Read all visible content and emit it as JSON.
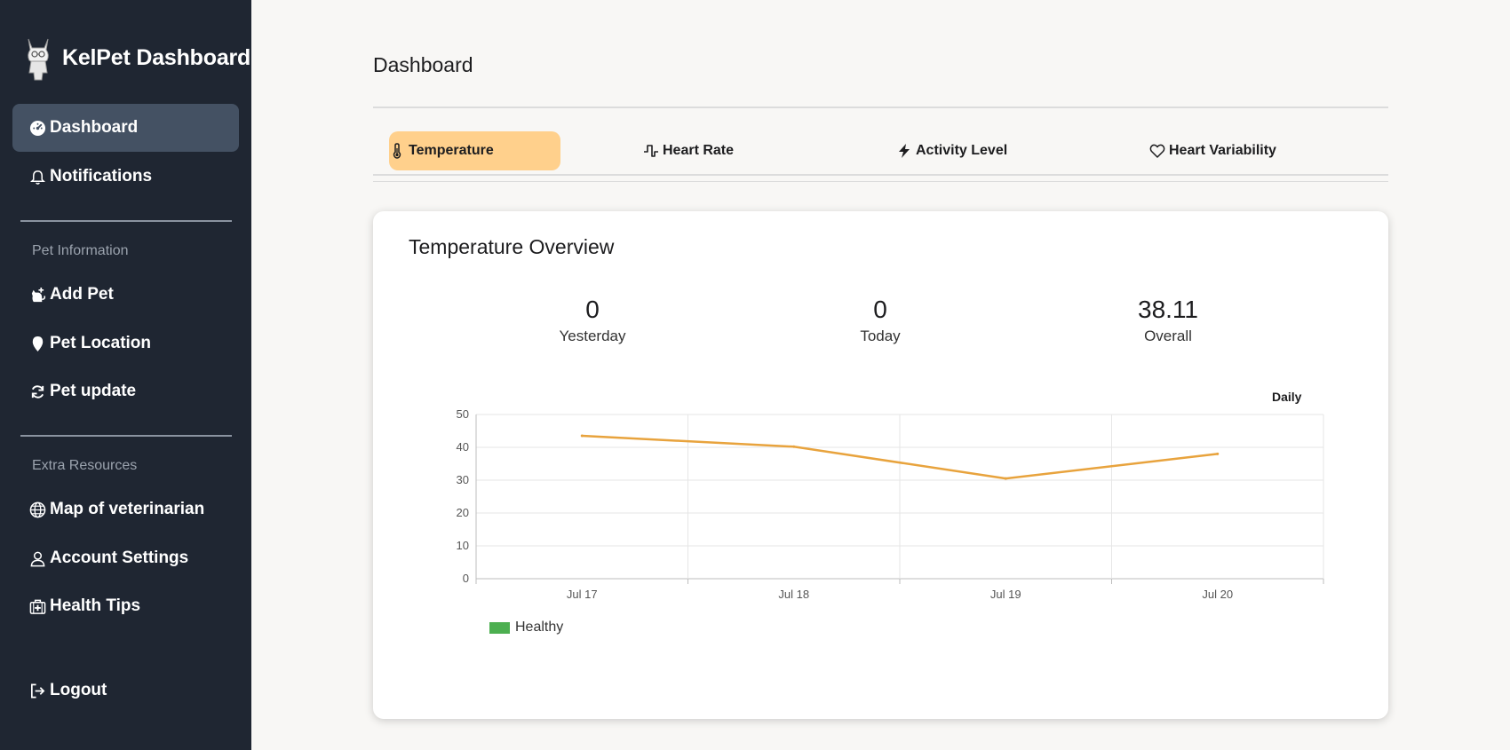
{
  "sidebar": {
    "brand": "KelPet Dashboard",
    "items": [
      {
        "label": "Dashboard",
        "icon": "dashboard-gauge-icon",
        "active": true
      },
      {
        "label": "Notifications",
        "icon": "bell-icon"
      }
    ],
    "sections": [
      {
        "label": "Pet Information",
        "items": [
          {
            "label": "Add Pet",
            "icon": "cat-add-icon"
          },
          {
            "label": "Pet Location",
            "icon": "map-pin-icon"
          },
          {
            "label": "Pet update",
            "icon": "refresh-icon"
          }
        ]
      },
      {
        "label": "Extra Resources",
        "items": [
          {
            "label": "Map of veterinarian",
            "icon": "globe-icon"
          },
          {
            "label": "Account Settings",
            "icon": "user-icon"
          },
          {
            "label": "Health Tips",
            "icon": "medical-kit-icon"
          }
        ]
      }
    ],
    "logout": {
      "label": "Logout",
      "icon": "logout-icon"
    }
  },
  "main": {
    "title": "Dashboard",
    "tabs": [
      {
        "label": "Temperature",
        "icon": "thermometer-icon",
        "active": true
      },
      {
        "label": "Heart Rate",
        "icon": "pulse-icon"
      },
      {
        "label": "Activity Level",
        "icon": "lightning-icon"
      },
      {
        "label": "Heart Variability",
        "icon": "heart-icon"
      }
    ],
    "card": {
      "title": "Temperature Overview",
      "stats": [
        {
          "value": "0",
          "label": "Yesterday"
        },
        {
          "value": "0",
          "label": "Today"
        },
        {
          "value": "38.11",
          "label": "Overall"
        }
      ],
      "period": "Daily"
    }
  },
  "colors": {
    "sidebar_bg": "#1f2632",
    "active_nav_bg": "#445163",
    "active_tab_bg": "#ffd08c",
    "line": "#e8a33d",
    "legend_swatch": "#4caf50"
  },
  "chart_data": {
    "type": "line",
    "categories": [
      "Jul 17",
      "Jul 18",
      "Jul 19",
      "Jul 20"
    ],
    "series": [
      {
        "name": "Healthy",
        "values": [
          43.5,
          40.2,
          30.5,
          38.0
        ],
        "color": "#e8a33d",
        "legend_color": "#4caf50"
      }
    ],
    "ylim": [
      0,
      50
    ],
    "yticks": [
      0,
      10,
      20,
      30,
      40,
      50
    ],
    "grid": true,
    "legend": "bottom-left"
  }
}
